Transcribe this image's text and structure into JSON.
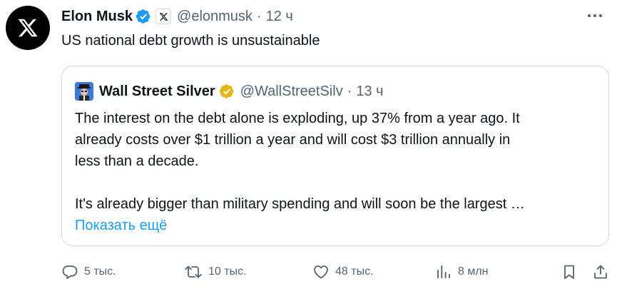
{
  "author": {
    "name": "Elon Musk",
    "handle": "@elonmusk",
    "separator": "·",
    "time": "12 ч"
  },
  "tweet": {
    "text": "US national debt growth is unsustainable"
  },
  "quote": {
    "name": "Wall Street Silver",
    "handle": "@WallStreetSilv",
    "separator": "·",
    "time": "13 ч",
    "lines": [
      "The interest on the debt alone is exploding, up 37% from a year ago. It",
      "already costs over $1 trillion a year and will cost $3 trillion annually in",
      "less than a decade."
    ],
    "line2": "It's already bigger than military spending and will soon be the largest …",
    "show_more": "Показать ещё"
  },
  "actions": {
    "replies": "5 тыс.",
    "reposts": "10 тыс.",
    "likes": "48 тыс.",
    "views": "8 млн"
  },
  "colors": {
    "verified_blue": "#1d9bf0",
    "verified_gold": "#e2b719",
    "text_secondary": "#536471",
    "link": "#1d9bf0"
  },
  "icons": [
    "x-logo-icon",
    "verified-icon",
    "x-badge-icon",
    "more-icon",
    "gold-verified-icon",
    "reply-icon",
    "repost-icon",
    "like-icon",
    "views-icon",
    "bookmark-icon",
    "share-icon"
  ]
}
